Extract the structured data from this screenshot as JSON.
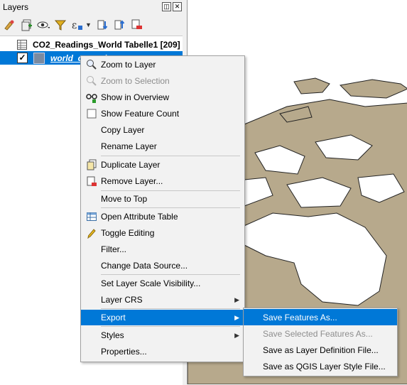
{
  "panel": {
    "title": "Layers",
    "float_glyph": "◫",
    "close_glyph": "✕",
    "toolbar_icons": [
      "style-manager-icon",
      "add-group-icon",
      "visibility-eye-icon",
      "filter-legend-icon",
      "expression-filter-icon",
      "expand-all-icon",
      "collapse-all-icon",
      "remove-layer-icon"
    ]
  },
  "tree": {
    "table_layer": "CO2_Readings_World Tabelle1 [209]",
    "vector_layer": "world_countries",
    "vector_checked": "✓"
  },
  "menu": {
    "items": [
      {
        "label": "Zoom to Layer",
        "icon": "zoom-icon"
      },
      {
        "label": "Zoom to Selection",
        "icon": "zoom-selection-icon",
        "disabled": true
      },
      {
        "label": "Show in Overview",
        "icon": "overview-icon"
      },
      {
        "label": "Show Feature Count",
        "icon": "checkbox-icon"
      },
      {
        "label": "Copy Layer",
        "icon": ""
      },
      {
        "label": "Rename Layer",
        "icon": ""
      },
      {
        "label": "Duplicate Layer",
        "icon": "duplicate-icon"
      },
      {
        "label": "Remove Layer...",
        "icon": "remove-icon"
      },
      {
        "label": "Move to Top",
        "icon": ""
      },
      {
        "label": "Open Attribute Table",
        "icon": "table-icon"
      },
      {
        "label": "Toggle Editing",
        "icon": "pencil-icon"
      },
      {
        "label": "Filter...",
        "icon": ""
      },
      {
        "label": "Change Data Source...",
        "icon": ""
      },
      {
        "label": "Set Layer Scale Visibility...",
        "icon": ""
      },
      {
        "label": "Layer CRS",
        "icon": "",
        "submenu": true
      },
      {
        "label": "Export",
        "icon": "",
        "submenu": true,
        "active": true
      },
      {
        "label": "Styles",
        "icon": "",
        "submenu": true
      },
      {
        "label": "Properties...",
        "icon": ""
      }
    ],
    "arrow_glyph": "▶"
  },
  "submenu": {
    "items": [
      {
        "label": "Save Features As...",
        "active": true
      },
      {
        "label": "Save Selected Features As...",
        "disabled": true
      },
      {
        "label": "Save as Layer Definition File..."
      },
      {
        "label": "Save as QGIS Layer Style File..."
      }
    ]
  },
  "colors": {
    "selection": "#0078d7",
    "land": "#b7a98c",
    "menu_bg": "#f2f2f2"
  }
}
